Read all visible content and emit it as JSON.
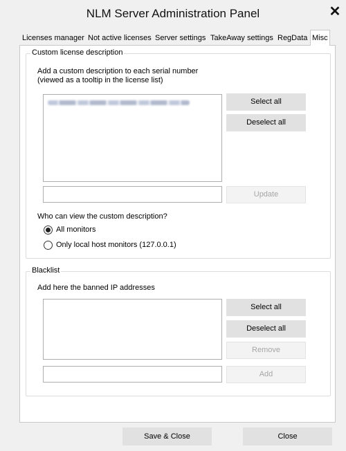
{
  "window": {
    "title": "NLM Server Administration Panel",
    "close_glyph": "✕"
  },
  "tabs": [
    {
      "label": "Licenses manager",
      "active": false
    },
    {
      "label": "Not active licenses",
      "active": false
    },
    {
      "label": "Server settings",
      "active": false
    },
    {
      "label": "TakeAway settings",
      "active": false
    },
    {
      "label": "RegData",
      "active": false
    },
    {
      "label": "Misc",
      "active": true
    }
  ],
  "custom_license": {
    "group_title": "Custom license description",
    "hint_line1": "Add a custom description to each serial number",
    "hint_line2": "(viewed as a tooltip in the license list)",
    "select_all_label": "Select all",
    "deselect_all_label": "Deselect all",
    "description_value": "",
    "update_label": "Update",
    "who_can_view_label": "Who can view the custom description?",
    "options": [
      {
        "label": "All monitors",
        "checked": true
      },
      {
        "label": "Only local host monitors (127.0.0.1)",
        "checked": false
      }
    ]
  },
  "blacklist": {
    "group_title": "Blacklist",
    "hint": "Add here the banned IP addresses",
    "select_all_label": "Select all",
    "deselect_all_label": "Deselect all",
    "remove_label": "Remove",
    "ip_value": "",
    "add_label": "Add"
  },
  "footer": {
    "save_close_label": "Save & Close",
    "close_label": "Close"
  },
  "colors": {
    "window_bg": "#f0f0f0",
    "panel_bg": "#ffffff",
    "button_bg": "#e1e1e1",
    "disabled_text": "#a6a6a6"
  }
}
